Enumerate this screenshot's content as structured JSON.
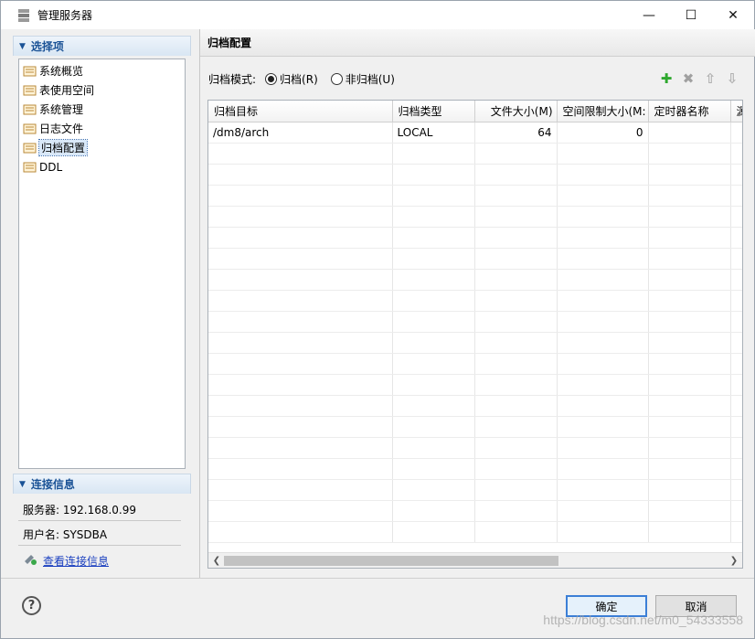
{
  "window": {
    "title": "管理服务器"
  },
  "left": {
    "section_title": "选择项",
    "items": [
      {
        "label": "系统概览"
      },
      {
        "label": "表使用空间"
      },
      {
        "label": "系统管理"
      },
      {
        "label": "日志文件"
      },
      {
        "label": "归档配置"
      },
      {
        "label": "DDL"
      }
    ],
    "conn_title": "连接信息",
    "server": "服务器: 192.168.0.99",
    "user": "用户名: SYSDBA",
    "view_link": "查看连接信息"
  },
  "right": {
    "title": "归档配置",
    "mode_label": "归档模式:",
    "archive_option": "归档(R)",
    "noarchive_option": "非归档(U)",
    "archive_selected": true,
    "columns": [
      "归档目标",
      "归档类型",
      "文件大小(M)",
      "空间限制大小(M:",
      "定时器名称",
      "源"
    ],
    "rows": [
      [
        "/dm8/arch",
        "LOCAL",
        "64",
        "0",
        "",
        ""
      ]
    ]
  },
  "buttons": {
    "ok": "确定",
    "cancel": "取消"
  },
  "watermark": "https://blog.csdn.net/m0_54333558",
  "colors": {
    "accent": "#1a5296",
    "add_green": "#2ea82e"
  }
}
